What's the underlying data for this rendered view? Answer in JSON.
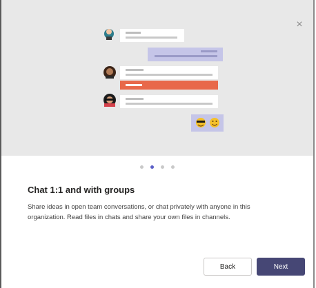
{
  "dialog": {
    "close_glyph": "×",
    "title": "Chat 1:1 and with groups",
    "description": "Share ideas in open team conversations, or chat privately with anyone in this organization. Read files in chats and share your own files in channels.",
    "back_label": "Back",
    "next_label": "Next"
  },
  "pagination": {
    "total": 4,
    "current": 2
  },
  "colors": {
    "hero_bg": "#e8e8e8",
    "accent": "#5b5fc7",
    "bubble_purple": "#c5c5e8",
    "bubble_highlight": "#e8684a",
    "next_button": "#464775"
  },
  "illustration": {
    "emoji_1": "😎",
    "emoji_2": "🙂"
  }
}
